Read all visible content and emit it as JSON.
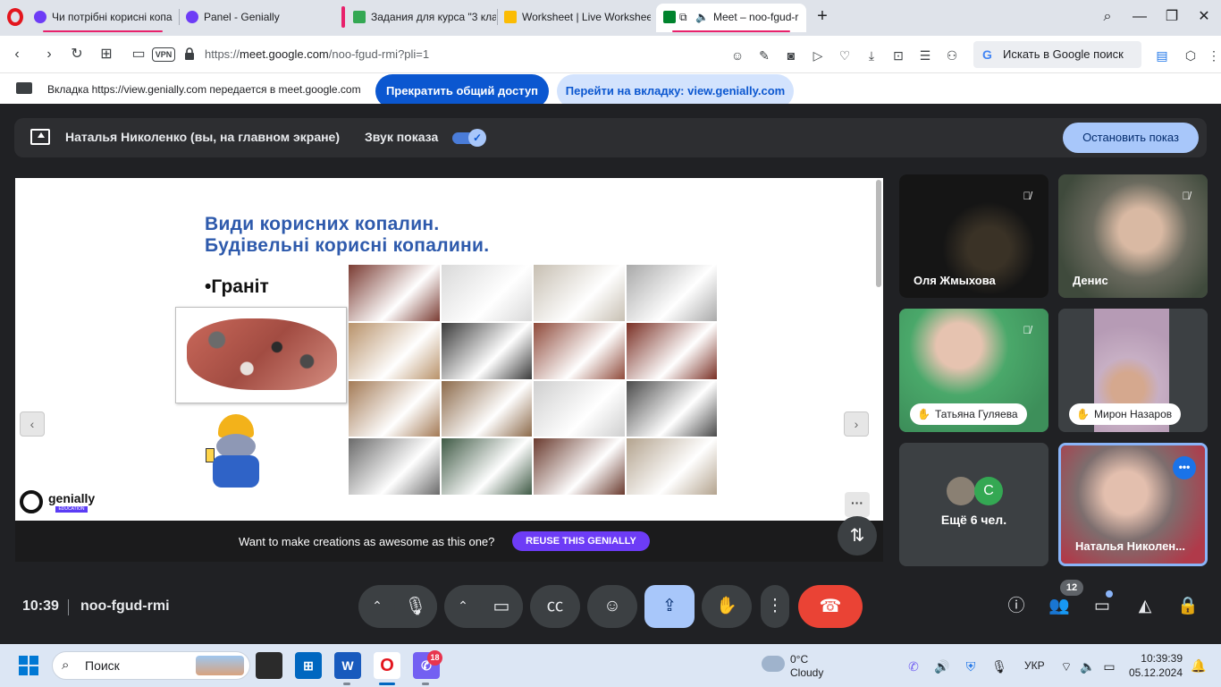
{
  "browser": {
    "tabs": [
      {
        "title": "Чи потрібні корисні копа",
        "favicon_color": "#6d3cf6"
      },
      {
        "title": "Panel - Genially",
        "favicon_color": "#6d3cf6"
      },
      {
        "title": "Задания для курса \"3 кла",
        "favicon_color": "#34a853"
      },
      {
        "title": "Worksheet | Live Workshee",
        "favicon_color": "#fbbc04"
      },
      {
        "title": "Meet – noo-fgud-r",
        "favicon_color": "#00832d"
      }
    ],
    "new_tab": "+",
    "vpn_label": "VPN",
    "url_prefix": "https://",
    "url_host": "meet.google.com",
    "url_path": "/noo-fgud-rmi?pli=1",
    "search_placeholder": "Искать в Google поиск",
    "search_logo": "G"
  },
  "share_bar": {
    "message": "Вкладка https://view.genially.com передается в meet.google.com",
    "stop_button": "Прекратить общий доступ",
    "goto_button": "Перейти на вкладку: view.genially.com"
  },
  "presenting": {
    "name": "Наталья Николенко (вы, на главном экране)",
    "sound_label": "Звук показа",
    "sound_on": true,
    "stop_button": "Остановить показ"
  },
  "slide": {
    "title_line1": "Види корисних копалин.",
    "title_line2": "Будівельні корисні копалини.",
    "bullet": "•Граніт",
    "logo_text": "genially",
    "logo_sub": "EDUCATION",
    "prev": "‹",
    "next": "›",
    "more": "···",
    "reuse_text": "Want to make creations as awesome as this one?",
    "reuse_button": "REUSE THIS GENIALLY",
    "collage_colors": [
      "#7a3b32",
      "#d9d9d9",
      "#c7bfb2",
      "#a9a9a9",
      "#b8926a",
      "#3a3a3a",
      "#8f4a3a",
      "#7a2f24",
      "#a37a55",
      "#8c6a4a",
      "#cfcfcf",
      "#4a4a4a",
      "#6a6a6a",
      "#3f5a45",
      "#6a3a2e",
      "#b3a38e"
    ]
  },
  "participants": [
    {
      "name": "Оля Жмыхова",
      "muted": true,
      "bg": "#151515"
    },
    {
      "name": "Денис",
      "muted": true,
      "bg": "#5b5a4f"
    },
    {
      "name": "Татьяна Гуляева",
      "muted": true,
      "hand": true,
      "bg": "#4aa86a"
    },
    {
      "name": "Мирон Назаров",
      "muted": false,
      "hand": true,
      "bg": "#b69bb5"
    },
    {
      "name": "Наталья Николен...",
      "muted": false,
      "bg": "#6a5a5a"
    }
  ],
  "more_participants": {
    "label": "Ещё 6 чел.",
    "avatar_letter": "C"
  },
  "meeting": {
    "time": "10:39",
    "code": "noo-fgud-rmi",
    "people_count": "12"
  },
  "icons": {
    "mic": "mic-icon",
    "camera": "camera-icon",
    "captions": "captions-icon",
    "emoji": "emoji-icon",
    "present": "present-icon",
    "hand": "raise-hand-icon",
    "more": "more-icon",
    "end": "end-call-icon"
  },
  "taskbar": {
    "search_label": "Поиск",
    "weather_temp": "0°C",
    "weather_desc": "Cloudy",
    "lang": "УКР",
    "time": "10:39:39",
    "date": "05.12.2024",
    "viber_badge": "18"
  }
}
